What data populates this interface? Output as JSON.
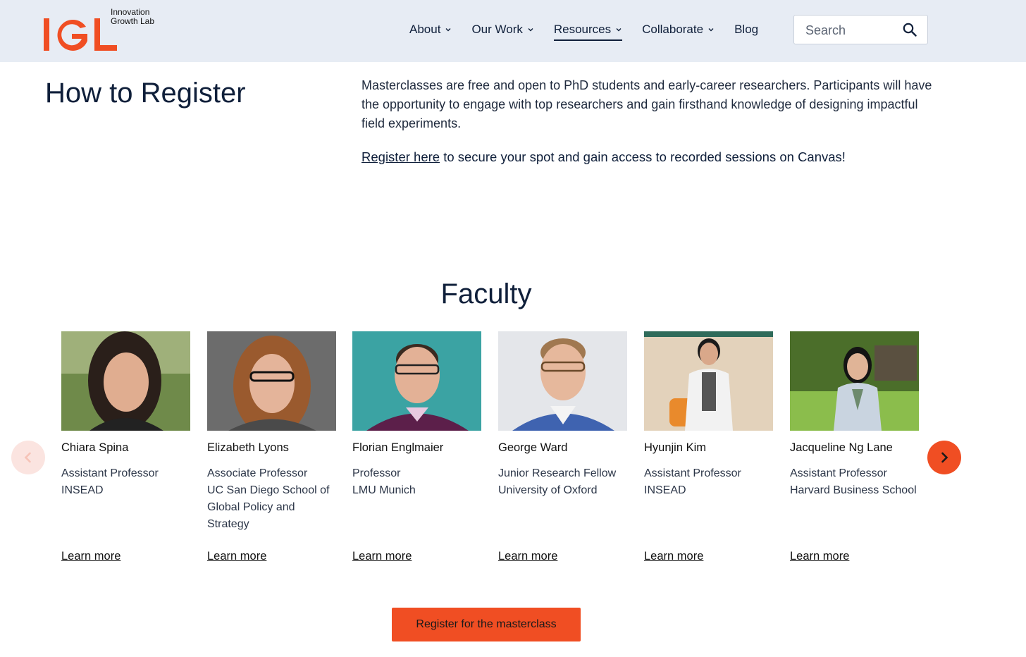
{
  "brand": {
    "logo_letters": "IGL",
    "logo_line1": "Innovation",
    "logo_line2": "Growth Lab",
    "accent": "#f04e23"
  },
  "nav": {
    "items": [
      {
        "label": "About",
        "has_menu": true
      },
      {
        "label": "Our Work",
        "has_menu": true
      },
      {
        "label": "Resources",
        "has_menu": true,
        "active": true
      },
      {
        "label": "Collaborate",
        "has_menu": true
      },
      {
        "label": "Blog",
        "has_menu": false
      }
    ],
    "search_placeholder": "Search"
  },
  "register": {
    "title": "How to Register",
    "text": "Masterclasses are free and open to PhD students and early-career researchers. Participants will have the opportunity to engage with top researchers and gain firsthand knowledge of designing impactful field experiments.",
    "link_label": "Register here",
    "cta_rest": " to secure your spot and gain access to recorded sessions on Canvas!"
  },
  "faculty": {
    "title": "Faculty",
    "learn_more_label": "Learn more",
    "members": [
      {
        "name": "Chiara Spina",
        "role": "Assistant Professor",
        "org": "INSEAD"
      },
      {
        "name": "Elizabeth Lyons",
        "role": "Associate Professor",
        "org": "UC San Diego School of Global Policy and Strategy"
      },
      {
        "name": "Florian Englmaier",
        "role": "Professor",
        "org": "LMU Munich"
      },
      {
        "name": "George Ward",
        "role": "Junior Research Fellow",
        "org": "University of Oxford"
      },
      {
        "name": "Hyunjin Kim",
        "role": "Assistant Professor",
        "org": "INSEAD"
      },
      {
        "name": "Jacqueline Ng Lane",
        "role": "Assistant Professor",
        "org": "Harvard Business School"
      }
    ]
  },
  "cta": {
    "register_button": "Register for the masterclass"
  },
  "icons": {
    "search": "search-icon",
    "prev": "chevron-left-icon",
    "next": "chevron-right-icon",
    "menu": "chevron-down-icon"
  }
}
